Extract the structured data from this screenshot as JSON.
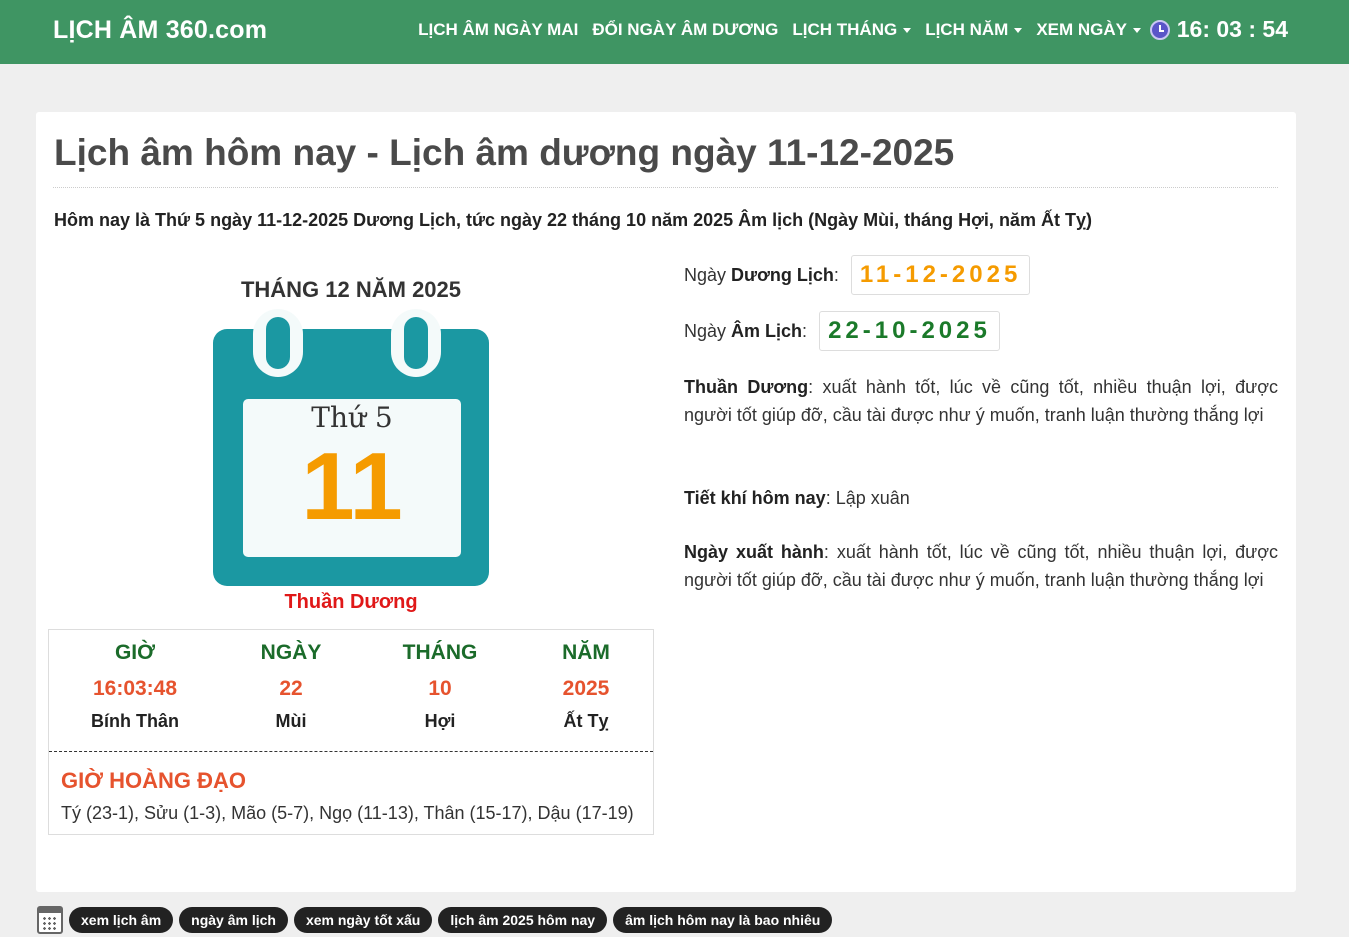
{
  "header": {
    "brand": "LỊCH ÂM 360.com",
    "nav": [
      {
        "label": "LỊCH ÂM NGÀY MAI",
        "dropdown": false
      },
      {
        "label": "ĐỔI NGÀY ÂM DƯƠNG",
        "dropdown": false
      },
      {
        "label": "LỊCH THÁNG",
        "dropdown": true
      },
      {
        "label": "LỊCH NĂM",
        "dropdown": true
      },
      {
        "label": "XEM NGÀY",
        "dropdown": true
      }
    ],
    "clock": "16: 03 : 54",
    "clock_icon": "clock-icon"
  },
  "main": {
    "title": "Lịch âm hôm nay - Lịch âm dương ngày 11-12-2025",
    "summary": "Hôm nay là Thứ 5 ngày 11-12-2025 Dương Lịch, tức ngày 22 tháng 10 năm 2025 Âm lịch (Ngày Mùi, tháng Hợi, năm Ất Tỵ)",
    "calendar": {
      "month_title": "THÁNG 12 NĂM 2025",
      "weekday": "Thứ 5",
      "day": "11",
      "label": "Thuần Dương"
    },
    "info_columns": [
      {
        "header": "GIỜ",
        "value": "16:03:48",
        "canchi": "Bính Thân"
      },
      {
        "header": "NGÀY",
        "value": "22",
        "canchi": "Mùi"
      },
      {
        "header": "THÁNG",
        "value": "10",
        "canchi": "Hợi"
      },
      {
        "header": "NĂM",
        "value": "2025",
        "canchi": "Ất Tỵ"
      }
    ],
    "hoang_dao": {
      "title": "GIỜ HOÀNG ĐẠO",
      "text": "Tý (23-1), Sửu (1-3), Mão (5-7), Ngọ (11-13), Thân (15-17), Dậu (17-19)"
    },
    "right": {
      "duong_prefix": "Ngày ",
      "duong_bold": "Dương Lịch",
      "duong_value": "11-12-2025",
      "am_prefix": "Ngày ",
      "am_bold": "Âm Lịch",
      "am_value": "22-10-2025",
      "thuan_duong_label": "Thuần Dương",
      "thuan_duong_text": ": xuất hành tốt, lúc về cũng tốt, nhiều thuận lợi, được người tốt giúp đỡ, cầu tài được như ý muốn, tranh luận thường thắng lợi",
      "tiet_khi_label": "Tiết khí hôm nay",
      "tiet_khi_text": ": Lập xuân",
      "xuat_hanh_label": "Ngày xuất hành",
      "xuat_hanh_text": ": xuất hành tốt, lúc về cũng tốt, nhiều thuận lợi, được người tốt giúp đỡ, cầu tài được như ý muốn, tranh luận thường thắng lợi"
    }
  },
  "tags": [
    "xem lịch âm",
    "ngày âm lịch",
    "xem ngày tốt xấu",
    "lịch âm 2025 hôm nay",
    "âm lịch hôm nay là bao nhiêu"
  ],
  "colors": {
    "header_bg": "#3f9563",
    "calendar_teal": "#1b98a2",
    "day_orange": "#f59b00",
    "accent_red": "#e6532e",
    "green_text": "#1b6b2a"
  }
}
